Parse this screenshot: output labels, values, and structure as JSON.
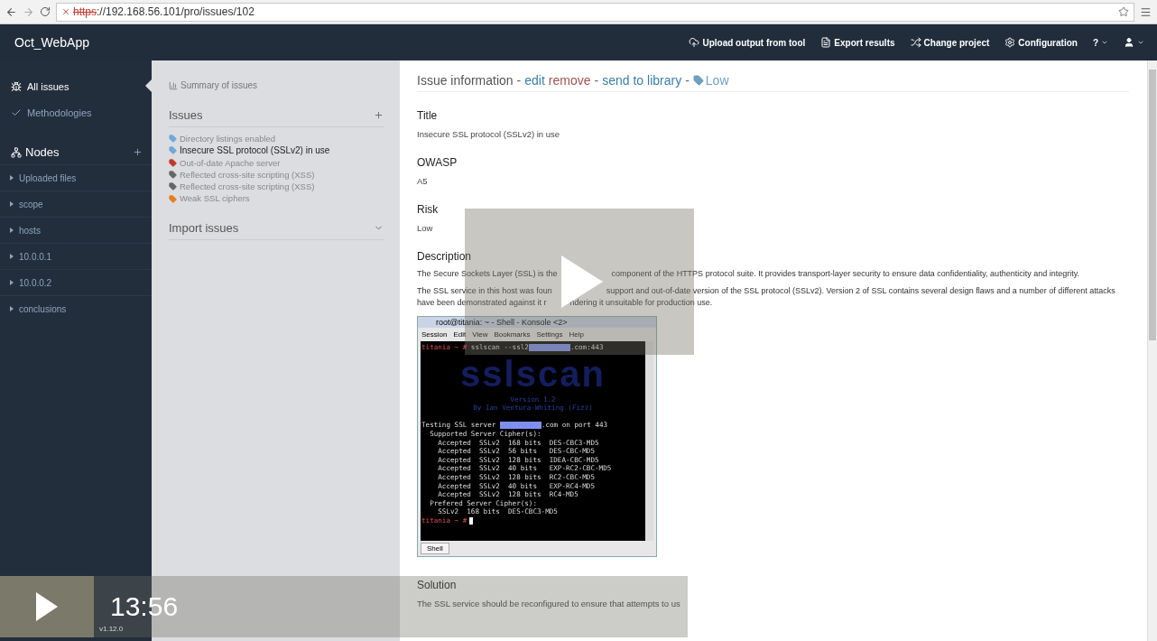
{
  "browser": {
    "scheme": "https",
    "url_rest": "://192.168.56.101/pro/issues/102",
    "insecure": true
  },
  "navbar": {
    "brand": "Oct_WebApp",
    "actions": [
      {
        "kind": "upload",
        "label": "Upload output from tool"
      },
      {
        "kind": "export",
        "label": "Export results"
      },
      {
        "kind": "shuffle",
        "label": "Change project"
      },
      {
        "kind": "gear",
        "label": "Configuration"
      },
      {
        "kind": "help",
        "label": "?"
      },
      {
        "kind": "user"
      }
    ]
  },
  "sidebar": {
    "items": [
      {
        "kind": "bug",
        "label": "All issues",
        "selected": true
      },
      {
        "kind": "check",
        "label": "Methodologies",
        "selected": false
      }
    ],
    "nodes_title": "Nodes",
    "nodes": [
      "Uploaded files",
      "scope",
      "hosts",
      "10.0.0.1",
      "10.0.0.2",
      "conclusions"
    ],
    "version": "v1.12.0"
  },
  "issues_panel": {
    "summary_link": "Summary of issues",
    "issues_title": "Issues",
    "issues": [
      {
        "label": "Directory listings enabled",
        "color": "#6fa8dc",
        "selected": false
      },
      {
        "label": "Insecure SSL protocol (SSLv2) in use",
        "color": "#6fa8dc",
        "selected": true
      },
      {
        "label": "Out-of-date Apache server",
        "color": "#c0392b",
        "selected": false
      },
      {
        "label": "Reflected cross-site scripting (XSS)",
        "color": "#666666",
        "selected": false
      },
      {
        "label": "Reflected cross-site scripting (XSS)",
        "color": "#666666",
        "selected": false
      },
      {
        "label": "Weak SSL ciphers",
        "color": "#e67e22",
        "selected": false
      }
    ],
    "import_title": "Import issues"
  },
  "issue": {
    "heading": "Issue information",
    "separator": "-",
    "actions": [
      {
        "kind": "edit",
        "label": "edit"
      },
      {
        "kind": "remove",
        "label": "remove"
      },
      {
        "kind": "library",
        "label": "send to library"
      }
    ],
    "tag": "Low",
    "fields": [
      {
        "title": "Title",
        "value": "Insecure SSL protocol (SSLv2) in use"
      },
      {
        "title": "OWASP",
        "value": "A5"
      },
      {
        "title": "Risk",
        "value": "Low"
      }
    ],
    "description_title": "Description",
    "paragraphs": [
      [
        "The Secure Sockets Layer (SSL) is the",
        "component of the HTTPS protocol suite. It provides transport-layer security to ensure data confidentiality, authenticity and integrity."
      ],
      [
        "The SSL service in this host was foun",
        "support and out-of-date version of the SSL protocol (SSLv2). Version 2 of SSL contains several design flaws and a number of different attacks have been demonstrated against it r",
        "ndering it unsuitable for production use."
      ]
    ],
    "terminal": {
      "title": "root@titania: ~ - Shell - Konsole <2>",
      "menu": [
        "Session",
        "Edit",
        "View",
        "Bookmarks",
        "Settings",
        "Help"
      ],
      "lines": [
        {
          "kind": "prompt",
          "prompt": "titania ~ #",
          "parts": [
            " sslscan --ssl2",
            ".com:443"
          ]
        },
        {
          "kind": "logo",
          "parts": [
            "sslscan"
          ]
        },
        {
          "kind": "blue",
          "parts": [
            "Version 1.2"
          ]
        },
        {
          "kind": "blue",
          "parts": [
            "By Ian Ventura-Whiting (Fizz)"
          ]
        },
        {
          "kind": "blank"
        },
        {
          "kind": "text",
          "parts": [
            "Testing SSL server ",
            ".com on port 443"
          ]
        },
        {
          "kind": "text",
          "parts": [
            "  Supported Server Cipher(s):"
          ]
        },
        {
          "kind": "text",
          "parts": [
            "    Accepted  SSLv2  168 bits  DES-CBC3-MD5"
          ]
        },
        {
          "kind": "text",
          "parts": [
            "    Accepted  SSLv2  56 bits   DES-CBC-MD5"
          ]
        },
        {
          "kind": "text",
          "parts": [
            "    Accepted  SSLv2  128 bits  IDEA-CBC-MD5"
          ]
        },
        {
          "kind": "text",
          "parts": [
            "    Accepted  SSLv2  40 bits   EXP-RC2-CBC-MD5"
          ]
        },
        {
          "kind": "text",
          "parts": [
            "    Accepted  SSLv2  128 bits  RC2-CBC-MD5"
          ]
        },
        {
          "kind": "text",
          "parts": [
            "    Accepted  SSLv2  40 bits   EXP-RC4-MD5"
          ]
        },
        {
          "kind": "text",
          "parts": [
            "    Accepted  SSLv2  128 bits  RC4-MD5"
          ]
        },
        {
          "kind": "text",
          "parts": [
            "  Prefered Server Cipher(s):"
          ]
        },
        {
          "kind": "text",
          "parts": [
            "    SSLv2  168 bits  DES-CBC3-MD5"
          ]
        },
        {
          "kind": "cursor",
          "prompt": "titania ~ #"
        }
      ],
      "tab": "Shell"
    },
    "solution": {
      "title": "Solution",
      "text": "The SSL service should be reconfigured to ensure that attempts to us"
    }
  },
  "player": {
    "time": "13:56"
  }
}
